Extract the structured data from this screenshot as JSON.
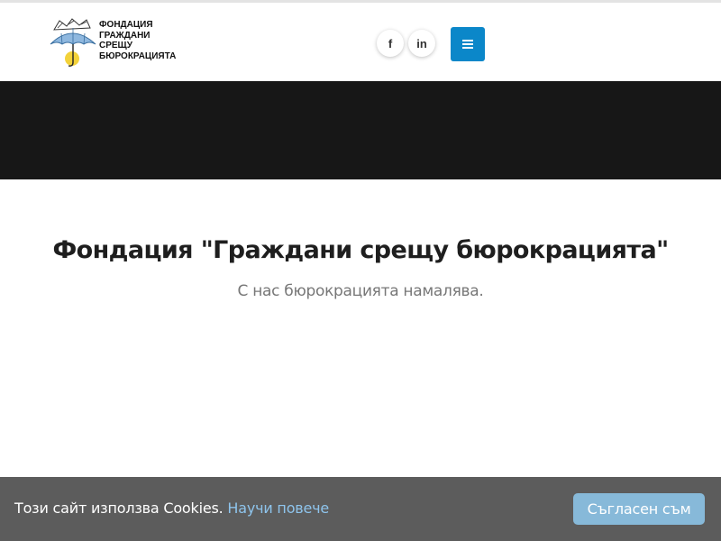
{
  "header": {
    "logo_text": "ФОНДАЦИЯ\nГРАЖДАНИ\nСРЕЩУ\nБЮРОКРАЦИЯТА",
    "social": [
      {
        "icon": "facebook-icon",
        "glyph": "f"
      },
      {
        "icon": "linkedin-icon",
        "glyph": "in"
      }
    ],
    "menu_icon": "hamburger-menu-icon"
  },
  "main": {
    "title": "Фондация \"Граждани срещу бюрокрацията\"",
    "subtitle": "С нас бюрокрацията намалява."
  },
  "cookie_bar": {
    "text": "Този сайт използва Cookies.",
    "link": "Научи повече",
    "accept_label": "Съгласен съм"
  },
  "colors": {
    "accent": "#0b87c9",
    "hero": "#171717",
    "cookie_bar": "#5c5c5c",
    "cookie_button": "#87b9d9",
    "cookie_link": "#8ec4ec"
  }
}
